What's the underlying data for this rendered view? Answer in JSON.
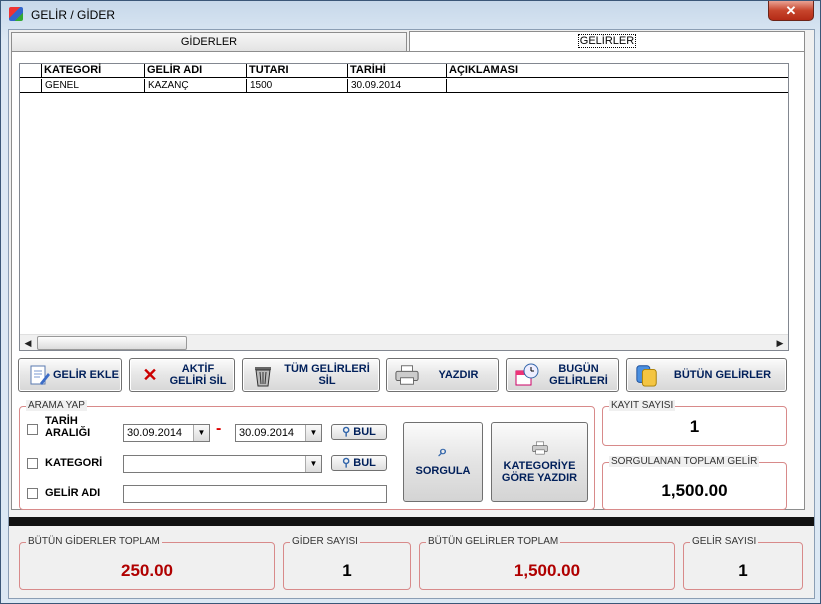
{
  "window": {
    "title": "GELİR / GİDER",
    "close_label": "✕"
  },
  "tabs": [
    {
      "label": "GİDERLER"
    },
    {
      "label": "GELİRLER"
    }
  ],
  "grid": {
    "columns": [
      "KATEGORİ",
      "GELİR ADI",
      "TUTARI",
      "TARİHİ",
      "AÇIKLAMASI"
    ],
    "rows": [
      {
        "kategori": "GENEL",
        "gelir_adi": "KAZANÇ",
        "tutari": "1500",
        "tarihi": "30.09.2014",
        "aciklamasi": ""
      }
    ]
  },
  "toolbar": {
    "gelir_ekle": "GELİR EKLE",
    "aktif_sil": "AKTİF GELİRİ SİL",
    "tum_sil": "TÜM GELİRLERİ SİL",
    "yazdir": "YAZDIR",
    "bugun": "BUGÜN GELİRLERİ",
    "butun": "BÜTÜN GELİRLER"
  },
  "search": {
    "group_title": "ARAMA YAP",
    "tarih_label": "TARİH ARALIĞI",
    "date_from": "30.09.2014",
    "dash": "-",
    "date_to": "30.09.2014",
    "bul_label": "BUL",
    "kategori_label": "KATEGORİ",
    "kategori_value": "",
    "gelir_adi_label": "GELİR ADI",
    "gelir_adi_value": "",
    "sorgula": "SORGULA",
    "kategoriye_gore": "KATEGORİYE GÖRE YAZDIR"
  },
  "stats": {
    "kayit_title": "KAYIT SAYISI",
    "kayit_value": "1",
    "sorgulanan_title": "SORGULANAN TOPLAM GELİR",
    "sorgulanan_value": "1,500.00"
  },
  "footer": {
    "gider_toplam_title": "BÜTÜN GİDERLER TOPLAM",
    "gider_toplam_value": "250.00",
    "gider_sayisi_title": "GİDER SAYISI",
    "gider_sayisi_value": "1",
    "gelir_toplam_title": "BÜTÜN GELİRLER TOPLAM",
    "gelir_toplam_value": "1,500.00",
    "gelir_sayisi_title": "GELİR SAYISI",
    "gelir_sayisi_value": "1"
  },
  "colors": {
    "accent_red": "#b00000",
    "group_border": "#d88a8a"
  }
}
